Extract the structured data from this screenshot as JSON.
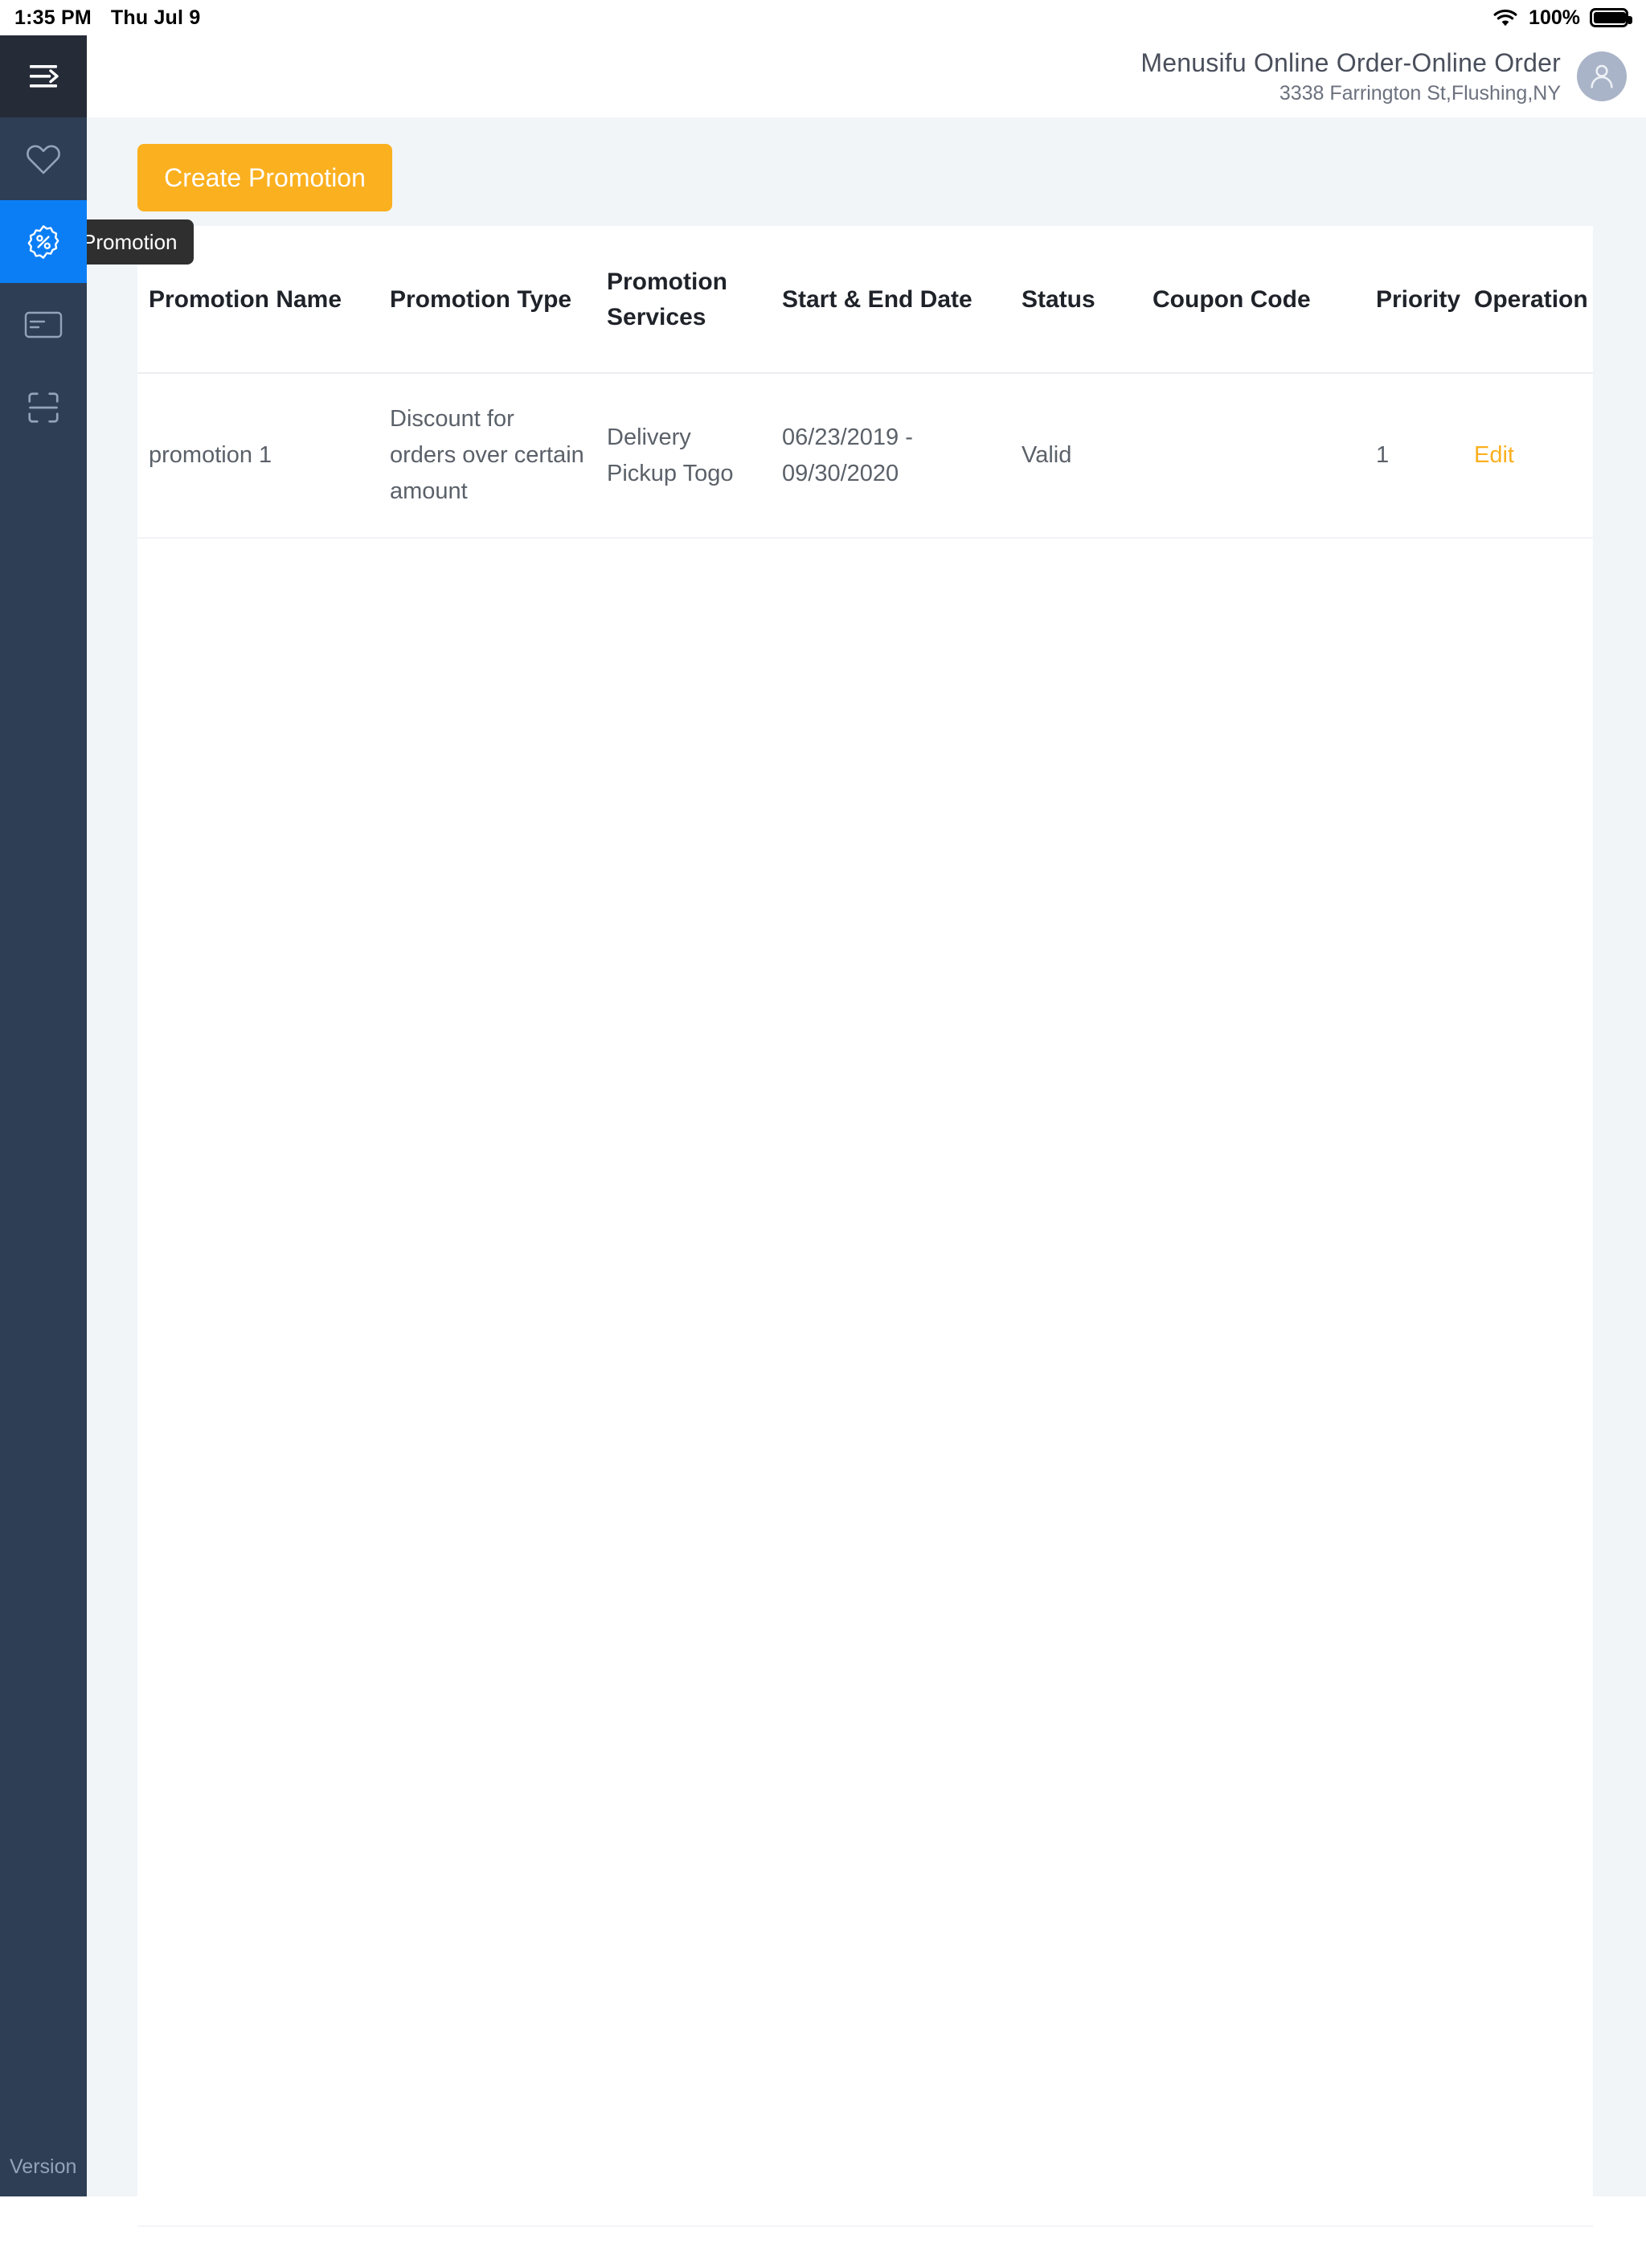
{
  "status_bar": {
    "time": "1:35 PM",
    "date": "Thu Jul 9",
    "battery_percent": "100%",
    "wifi_icon": "wifi-icon",
    "battery_icon": "battery-full-icon"
  },
  "sidebar": {
    "menu_icon": "menu-arrow-icon",
    "version_label": "Version",
    "items": [
      {
        "name": "sidebar-item-favorites",
        "icon": "heart-icon",
        "active": false
      },
      {
        "name": "sidebar-item-promotion",
        "icon": "percent-badge-icon",
        "active": true
      },
      {
        "name": "sidebar-item-payment",
        "icon": "credit-card-icon",
        "active": false
      },
      {
        "name": "sidebar-item-scan",
        "icon": "scan-frame-icon",
        "active": false
      }
    ],
    "active_color": "#0b7ef5",
    "background_color": "#2e3e55",
    "top_background_color": "#262b38"
  },
  "header": {
    "title": "Menusifu Online Order-Online Order",
    "subtitle": "3338 Farrington St,Flushing,NY",
    "avatar_icon": "user-avatar-icon"
  },
  "toolbar": {
    "create_label": "Create Promotion",
    "create_color": "#fbb01f"
  },
  "tooltip": {
    "text": "Promotion"
  },
  "table": {
    "columns": [
      "Promotion Name",
      "Promotion Type",
      "Promotion Services",
      "Start & End Date",
      "Status",
      "Coupon Code",
      "Priority",
      "Operation"
    ],
    "rows": [
      {
        "promotion_name": "promotion 1",
        "promotion_type": "Discount for orders over certain amount",
        "promotion_services": "Delivery Pickup Togo",
        "start_end_date": "06/23/2019 - 09/30/2020",
        "status": "Valid",
        "coupon_code": "",
        "priority": "1",
        "operation": "Edit"
      }
    ]
  }
}
